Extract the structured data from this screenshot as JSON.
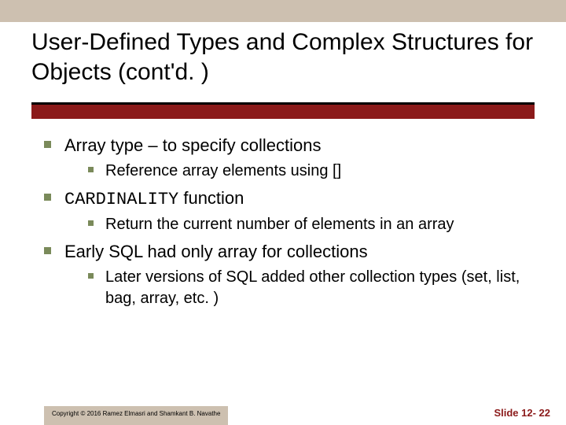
{
  "title": "User-Defined Types and Complex Structures for Objects (cont'd. )",
  "bullets": [
    {
      "text": "Array type – to specify collections",
      "sub": [
        {
          "text": "Reference array elements using []"
        }
      ]
    },
    {
      "mono": "CARDINALITY",
      "tail": " function",
      "sub": [
        {
          "text": "Return the current number of elements in an array"
        }
      ]
    },
    {
      "text": "Early SQL had only array for collections",
      "sub": [
        {
          "text": " Later versions of SQL added other collection types (set, list, bag, array, etc. )"
        }
      ]
    }
  ],
  "footer": {
    "copyright": "Copyright © 2016 Ramez Elmasri and Shamkant B. Navathe",
    "slidenum": "Slide 12- 22"
  }
}
